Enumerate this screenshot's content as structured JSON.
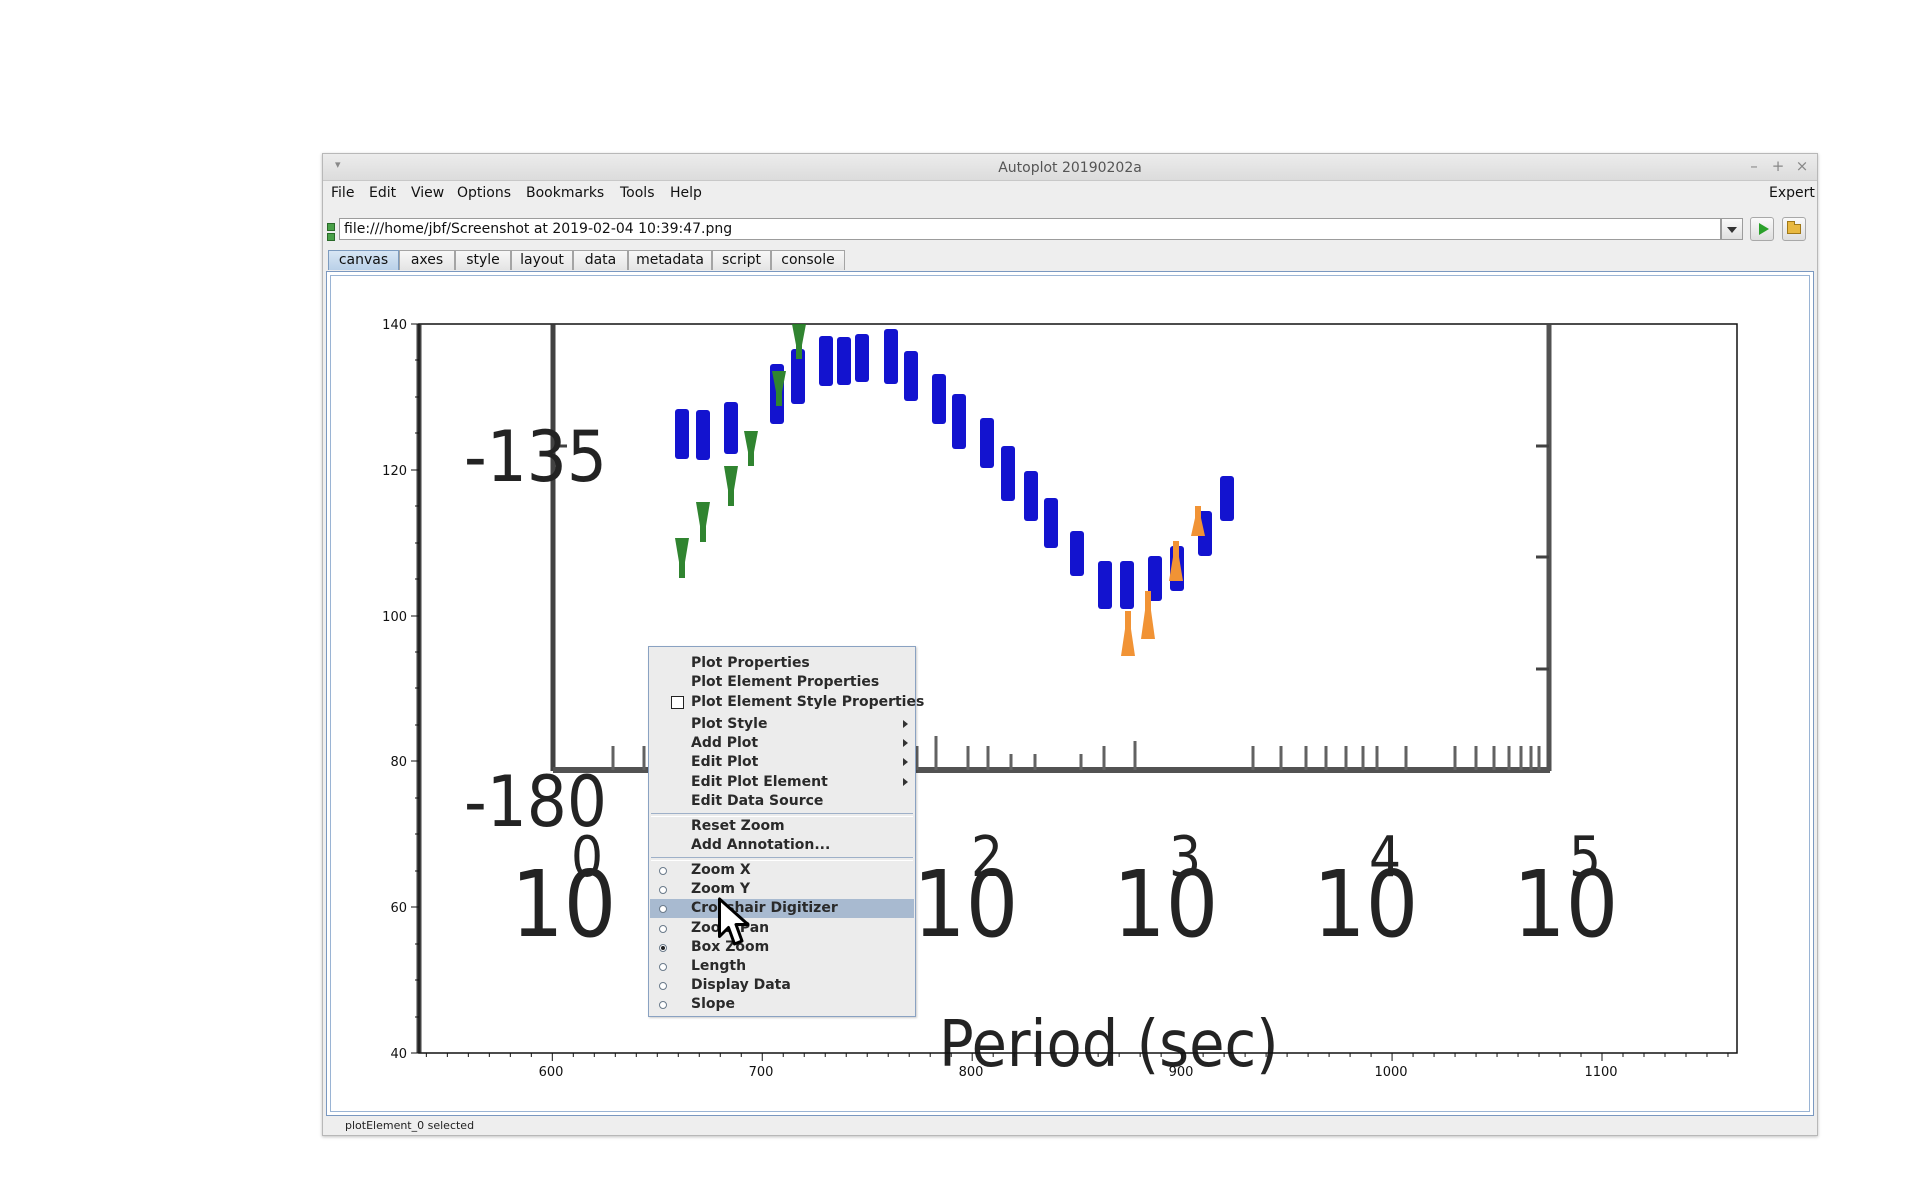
{
  "window": {
    "title": "Autoplot 20190202a",
    "controls": {
      "minimize": "–",
      "maximize": "+",
      "close": "×"
    }
  },
  "menu": {
    "items": [
      "File",
      "Edit",
      "View",
      "Options",
      "Bookmarks",
      "Tools",
      "Help"
    ],
    "right": "Expert"
  },
  "url_bar": {
    "value": "file:///home/jbf/Screenshot at 2019-02-04 10:39:47.png"
  },
  "tabs": [
    {
      "label": "canvas",
      "selected": true
    },
    {
      "label": "axes"
    },
    {
      "label": "style"
    },
    {
      "label": "layout"
    },
    {
      "label": "data"
    },
    {
      "label": "metadata"
    },
    {
      "label": "script"
    },
    {
      "label": "console"
    }
  ],
  "plot": {
    "x_ticks": [
      "600",
      "700",
      "800",
      "900",
      "1000",
      "1100"
    ],
    "y_ticks": [
      "40",
      "60",
      "80",
      "100",
      "120",
      "140"
    ],
    "image_overlay": {
      "labels": [
        "-135",
        "-180"
      ],
      "decade_labels": [
        "10",
        "0",
        "10",
        "2",
        "10",
        "3",
        "10",
        "4",
        "10",
        "5"
      ],
      "axis_title": "Period (sec)",
      "colors": {
        "blue": "#0000cc",
        "green": "#1f7a1f",
        "orange": "#f08a24",
        "frame": "#111111"
      }
    }
  },
  "context_menu": {
    "items": [
      {
        "label": "Plot Properties"
      },
      {
        "label": "Plot Element Properties"
      },
      {
        "label": "Plot Element Style Properties",
        "checkbox": false
      },
      {
        "label": "Plot Style",
        "submenu": true
      },
      {
        "label": "Add Plot",
        "submenu": true
      },
      {
        "label": "Edit Plot",
        "submenu": true
      },
      {
        "label": "Edit Plot Element",
        "submenu": true
      },
      {
        "label": "Edit Data Source"
      },
      {
        "label": "Reset Zoom"
      },
      {
        "label": "Add Annotation..."
      },
      {
        "label": "Zoom X",
        "radio": true
      },
      {
        "label": "Zoom Y",
        "radio": true
      },
      {
        "label": "Crosshair Digitizer",
        "radio": true,
        "highlighted": true
      },
      {
        "label": "Zoom Pan",
        "radio": true
      },
      {
        "label": "Box Zoom",
        "radio": true,
        "checked": true
      },
      {
        "label": "Length",
        "radio": true
      },
      {
        "label": "Display Data",
        "radio": true
      },
      {
        "label": "Slope",
        "radio": true
      }
    ]
  },
  "status_bar": {
    "text": "plotElement_0 selected"
  }
}
